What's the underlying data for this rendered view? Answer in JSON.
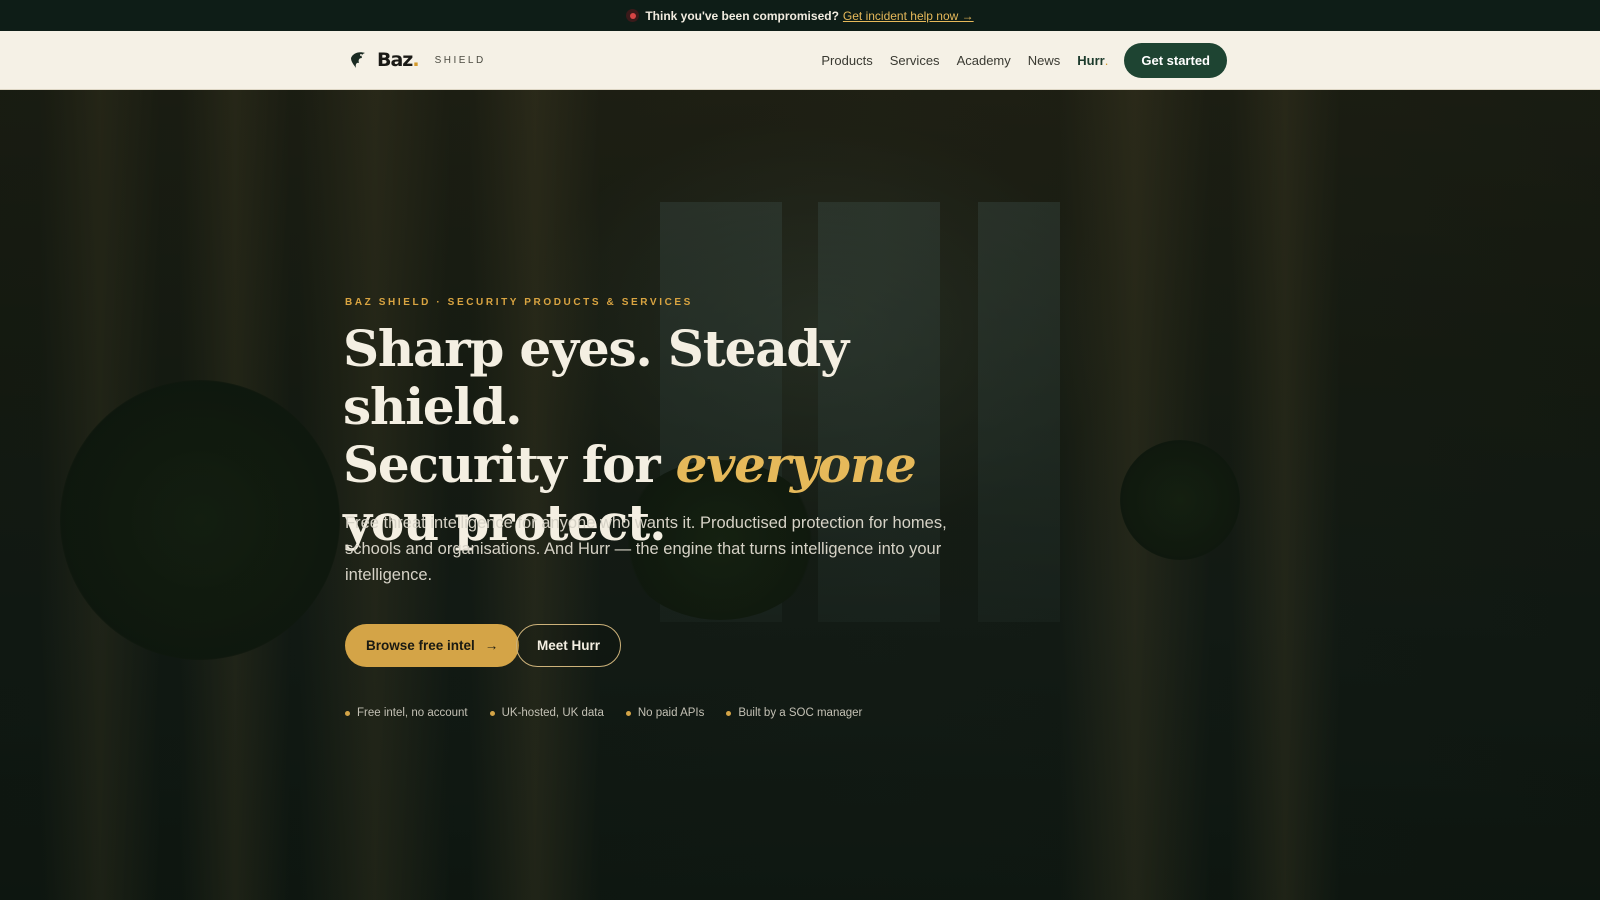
{
  "colors": {
    "alert_bg": "#0e1d17",
    "header_bg": "#f5f1e6",
    "brand_green": "#1e4432",
    "gold": "#d4a447",
    "accent_text": "#e6b95a",
    "alert_dot": "#d64545"
  },
  "alert": {
    "text": "Think you've been compromised?",
    "link": "Get incident help now →",
    "icon": "alert-dot-icon"
  },
  "header": {
    "logo_word": "Baz",
    "logo_dot": ".",
    "logo_sub": "SHIELD",
    "logo_icon": "hawk-icon",
    "nav": {
      "products": "Products",
      "services": "Services",
      "academy": "Academy",
      "news": "News",
      "hurr": "Hurr",
      "hurr_dot": "."
    },
    "cta": "Get started"
  },
  "hero": {
    "eyebrow": "BAZ SHIELD · SECURITY PRODUCTS & SERVICES",
    "headline_line1": "Sharp eyes. Steady shield.",
    "headline_pre": "Security for ",
    "headline_accent": "everyone",
    "headline_post": " you protect.",
    "lede": "Free threat intelligence for anyone who wants it. Productised protection for homes, schools and organisations. And Hurr — the engine that turns intelligence into your intelligence.",
    "primary_button": "Browse free intel",
    "primary_arrow": "→",
    "secondary_button": "Meet Hurr",
    "features": [
      "Free intel, no account",
      "UK-hosted, UK data",
      "No paid APIs",
      "Built by a SOC manager"
    ]
  }
}
